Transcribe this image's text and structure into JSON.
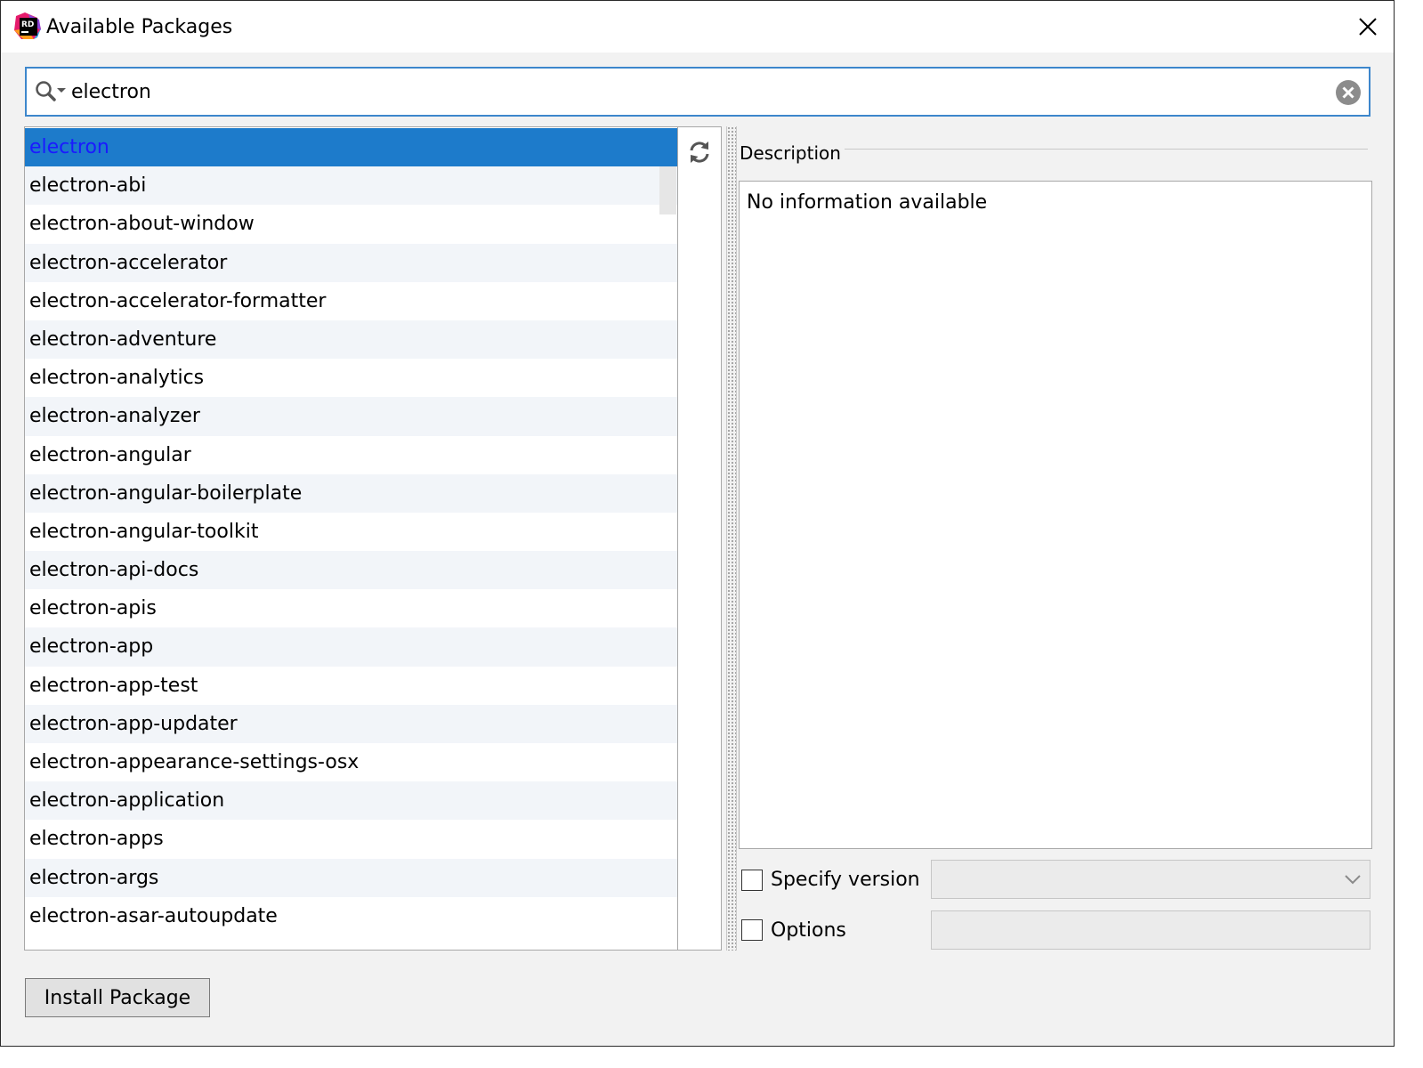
{
  "window": {
    "title": "Available Packages",
    "logo_text": "RD"
  },
  "search": {
    "value": "electron"
  },
  "packages": {
    "selected_index": 0,
    "items": [
      "electron",
      "electron-abi",
      "electron-about-window",
      "electron-accelerator",
      "electron-accelerator-formatter",
      "electron-adventure",
      "electron-analytics",
      "electron-analyzer",
      "electron-angular",
      "electron-angular-boilerplate",
      "electron-angular-toolkit",
      "electron-api-docs",
      "electron-apis",
      "electron-app",
      "electron-app-test",
      "electron-app-updater",
      "electron-appearance-settings-osx",
      "electron-application",
      "electron-apps",
      "electron-args",
      "electron-asar-autoupdate"
    ]
  },
  "description": {
    "label": "Description",
    "text": "No information available"
  },
  "specify_version": {
    "label": "Specify version",
    "checked": false,
    "selected_value": ""
  },
  "options": {
    "label": "Options",
    "checked": false,
    "value": ""
  },
  "buttons": {
    "install_label": "Install Package"
  },
  "colors": {
    "selection_bg": "#1d7bcb",
    "selection_text": "#1a1aff",
    "search_border": "#3d87cc",
    "stripe": "#f2f5f9"
  },
  "icons": {
    "app": "rider-logo-icon",
    "close": "close-icon",
    "search": "search-dropdown-icon",
    "clear": "clear-search-icon",
    "refresh": "refresh-icon",
    "dropdown": "chevron-down-icon"
  }
}
